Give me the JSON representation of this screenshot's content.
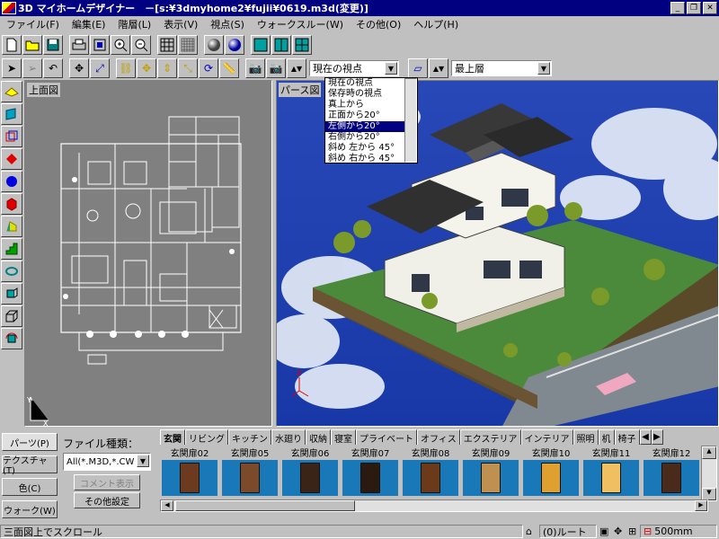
{
  "window": {
    "title": "3D マイホームデザイナー　－[s:¥3dmyhome2¥fujii¥0619.m3d(変更)]"
  },
  "menu": [
    "ファイル(F)",
    "編集(E)",
    "階層(L)",
    "表示(V)",
    "視点(S)",
    "ウォークスルー(W)",
    "その他(O)",
    "ヘルプ(H)"
  ],
  "toolbar2": {
    "viewpoint_select": "現在の視点",
    "floor_select": "最上層"
  },
  "viewpoint_list": [
    "現在の視点",
    "保存時の視点",
    "真上から",
    "正面から20°",
    "左側から20°",
    "右側から20°",
    "斜め 左から 45°",
    "斜め 右から 45°"
  ],
  "viewpoint_selected_index": 4,
  "views": {
    "top_label": "上面図",
    "persp_label": "パース図"
  },
  "side_tabs": [
    "パーツ(P)",
    "テクスチャ(T)",
    "色(C)",
    "ウォーク(W)"
  ],
  "file_type": {
    "label": "ファイル種類：",
    "value": "All(*.M3D,*.CW"
  },
  "buttons": {
    "comment": "コメント表示",
    "other_settings": "その他設定"
  },
  "category_tabs": [
    "玄関",
    "リビング",
    "キッチン",
    "水廻り",
    "収納",
    "寝室",
    "プライベート",
    "オフィス",
    "エクステリア",
    "インテリア",
    "照明",
    "机",
    "椅子"
  ],
  "parts": [
    {
      "label": "玄関扉02",
      "color": "#6b3a1f"
    },
    {
      "label": "玄関扉05",
      "color": "#7a4a2a"
    },
    {
      "label": "玄関扉06",
      "color": "#3a2418"
    },
    {
      "label": "玄関扉07",
      "color": "#2a1a10"
    },
    {
      "label": "玄関扉08",
      "color": "#6a3a1a"
    },
    {
      "label": "玄関扉09",
      "color": "#c09050"
    },
    {
      "label": "玄関扉10",
      "color": "#e0a030"
    },
    {
      "label": "玄関扉11",
      "color": "#f0c060"
    },
    {
      "label": "玄関扉12",
      "color": "#4a2a1a"
    }
  ],
  "status": {
    "message": "三面図上でスクロール",
    "route": "(0)ルート",
    "scale": "500mm"
  },
  "colors": {
    "titlebar": "#000080",
    "selection": "#000080",
    "parts_bg": "#1878b8",
    "sky": "#1838a8"
  }
}
